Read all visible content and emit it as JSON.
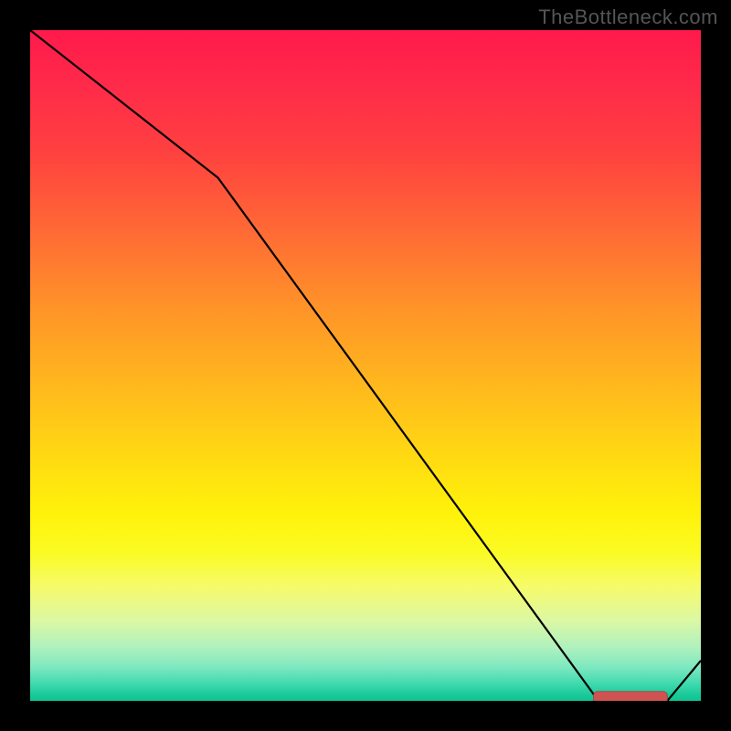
{
  "watermark": "TheBottleneck.com",
  "chart_data": {
    "type": "line",
    "title": "",
    "xlabel": "",
    "ylabel": "",
    "xlim": [
      0,
      100
    ],
    "ylim": [
      0,
      100
    ],
    "x": [
      0,
      28,
      84,
      88,
      92,
      95,
      100
    ],
    "values": [
      100,
      78,
      1,
      0,
      0,
      0,
      6
    ],
    "marker_segment": {
      "x_start": 84,
      "x_end": 95,
      "y": 0.5
    },
    "colors": {
      "line": "#000000",
      "marker": "#cf5352",
      "gradient_top": "#ff1a4b",
      "gradient_bottom": "#0fc493",
      "background": "#000000"
    }
  }
}
